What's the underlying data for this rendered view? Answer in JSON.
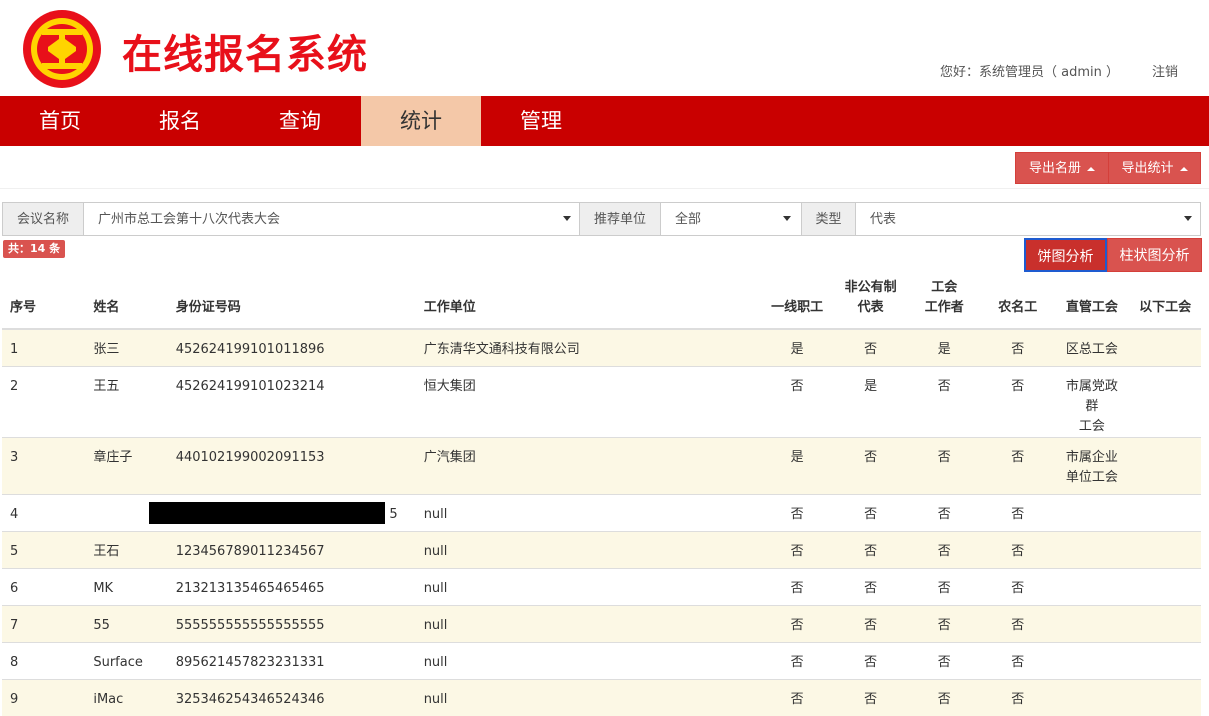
{
  "header": {
    "logo_icon": "union-emblem-icon",
    "title": "在线报名系统",
    "greeting": "您好：系统管理员（ admin ）",
    "logout": "注销"
  },
  "nav": {
    "items": [
      {
        "label": "首页",
        "active": false
      },
      {
        "label": "报名",
        "active": false
      },
      {
        "label": "查询",
        "active": false
      },
      {
        "label": "统计",
        "active": true
      },
      {
        "label": "管理",
        "active": false
      }
    ]
  },
  "toolbar": {
    "export_roster": "导出名册",
    "export_stats": "导出统计"
  },
  "filters": {
    "meeting_label": "会议名称",
    "meeting_value": "广州市总工会第十八次代表大会",
    "unit_label": "推荐单位",
    "unit_value": "全部",
    "type_label": "类型",
    "type_value": "代表"
  },
  "summary": {
    "count": "共：14 条"
  },
  "chart_buttons": {
    "pie": "饼图分析",
    "bar": "柱状图分析"
  },
  "table": {
    "headers": {
      "seq": "序号",
      "name": "姓名",
      "id": "身份证号码",
      "unit": "工作单位",
      "frontline_line1": "一线职工",
      "nonpublic_line1": "非公有制",
      "nonpublic_line2": "代表",
      "union_line1": "工会",
      "union_line2": "工作者",
      "migrant": "农名工",
      "direct_union": "直管工会",
      "sub_union": "以下工会"
    },
    "rows": [
      {
        "seq": "1",
        "name": "张三",
        "id": "452624199101011896",
        "unit": "广东清华文通科技有限公司",
        "frontline": "是",
        "nonpublic": "否",
        "union": "是",
        "migrant": "否",
        "direct": "区总工会",
        "sub": ""
      },
      {
        "seq": "2",
        "name": "王五",
        "id": "452624199101023214",
        "unit": "恒大集团",
        "frontline": "否",
        "nonpublic": "是",
        "union": "否",
        "migrant": "否",
        "direct": "市属党政群工会",
        "sub": ""
      },
      {
        "seq": "3",
        "name": "章庄子",
        "id": "440102199002091153",
        "unit": "广汽集团",
        "frontline": "是",
        "nonpublic": "否",
        "union": "否",
        "migrant": "否",
        "direct": "市属企业单位工会",
        "sub": ""
      },
      {
        "seq": "4",
        "name": "",
        "id": "5",
        "unit": "null",
        "frontline": "否",
        "nonpublic": "否",
        "union": "否",
        "migrant": "否",
        "direct": "",
        "sub": "",
        "redacted": true
      },
      {
        "seq": "5",
        "name": "王石",
        "id": "123456789011234567",
        "unit": "null",
        "frontline": "否",
        "nonpublic": "否",
        "union": "否",
        "migrant": "否",
        "direct": "",
        "sub": ""
      },
      {
        "seq": "6",
        "name": "MK",
        "id": "213213135465465465",
        "unit": "null",
        "frontline": "否",
        "nonpublic": "否",
        "union": "否",
        "migrant": "否",
        "direct": "",
        "sub": ""
      },
      {
        "seq": "7",
        "name": "55",
        "id": "555555555555555555",
        "unit": "null",
        "frontline": "否",
        "nonpublic": "否",
        "union": "否",
        "migrant": "否",
        "direct": "",
        "sub": ""
      },
      {
        "seq": "8",
        "name": "Surface",
        "id": "895621457823231331",
        "unit": "null",
        "frontline": "否",
        "nonpublic": "否",
        "union": "否",
        "migrant": "否",
        "direct": "",
        "sub": ""
      },
      {
        "seq": "9",
        "name": "iMac",
        "id": "325346254346524346",
        "unit": "null",
        "frontline": "否",
        "nonpublic": "否",
        "union": "否",
        "migrant": "否",
        "direct": "",
        "sub": ""
      }
    ]
  },
  "colors": {
    "brand_red": "#c90000",
    "title_red": "#e8101a",
    "active_tab": "#f4c8a8",
    "button_red": "#d9534f",
    "stripe": "#fcf8e5"
  }
}
